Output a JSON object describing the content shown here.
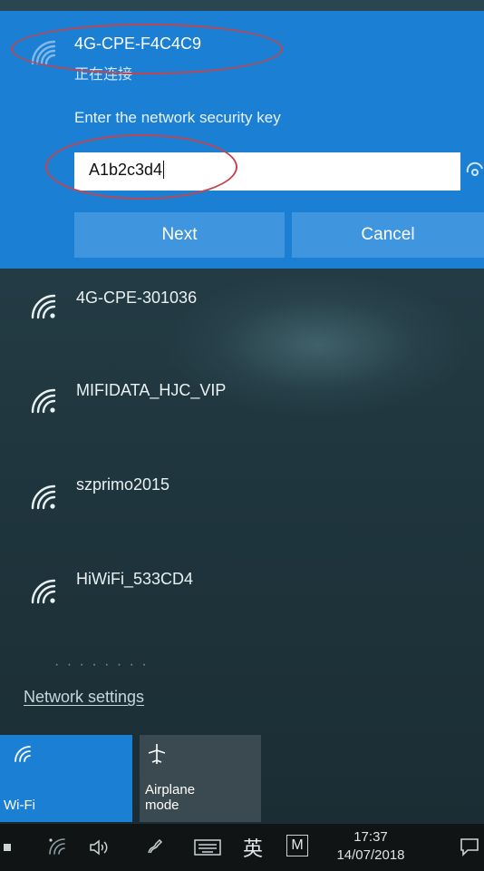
{
  "selected_network": {
    "name": "4G-CPE-F4C4C9",
    "status": "正在连接",
    "key_prompt": "Enter the network security key",
    "key_value": "A1b2c3d4",
    "next_label": "Next",
    "cancel_label": "Cancel"
  },
  "networks": [
    {
      "name": "4G-CPE-301036"
    },
    {
      "name": "MIFIDATA_HJC_VIP"
    },
    {
      "name": "szprimo2015"
    },
    {
      "name": "HiWiFi_533CD4"
    }
  ],
  "partial_item": "· · ·   · · · · ·",
  "network_settings_label": "Network settings",
  "quick_actions": [
    {
      "label": "Wi-Fi",
      "icon": "wifi-icon",
      "active": true
    },
    {
      "label": "Airplane\nmode",
      "icon": "airplane-icon",
      "active": false
    }
  ],
  "taskbar": {
    "ime_label": "英",
    "ime_mode": "M",
    "time": "17:37",
    "date": "14/07/2018"
  },
  "colors": {
    "accent": "#1b7fd4",
    "button": "#3f95de",
    "annotation": "#c0474f"
  }
}
